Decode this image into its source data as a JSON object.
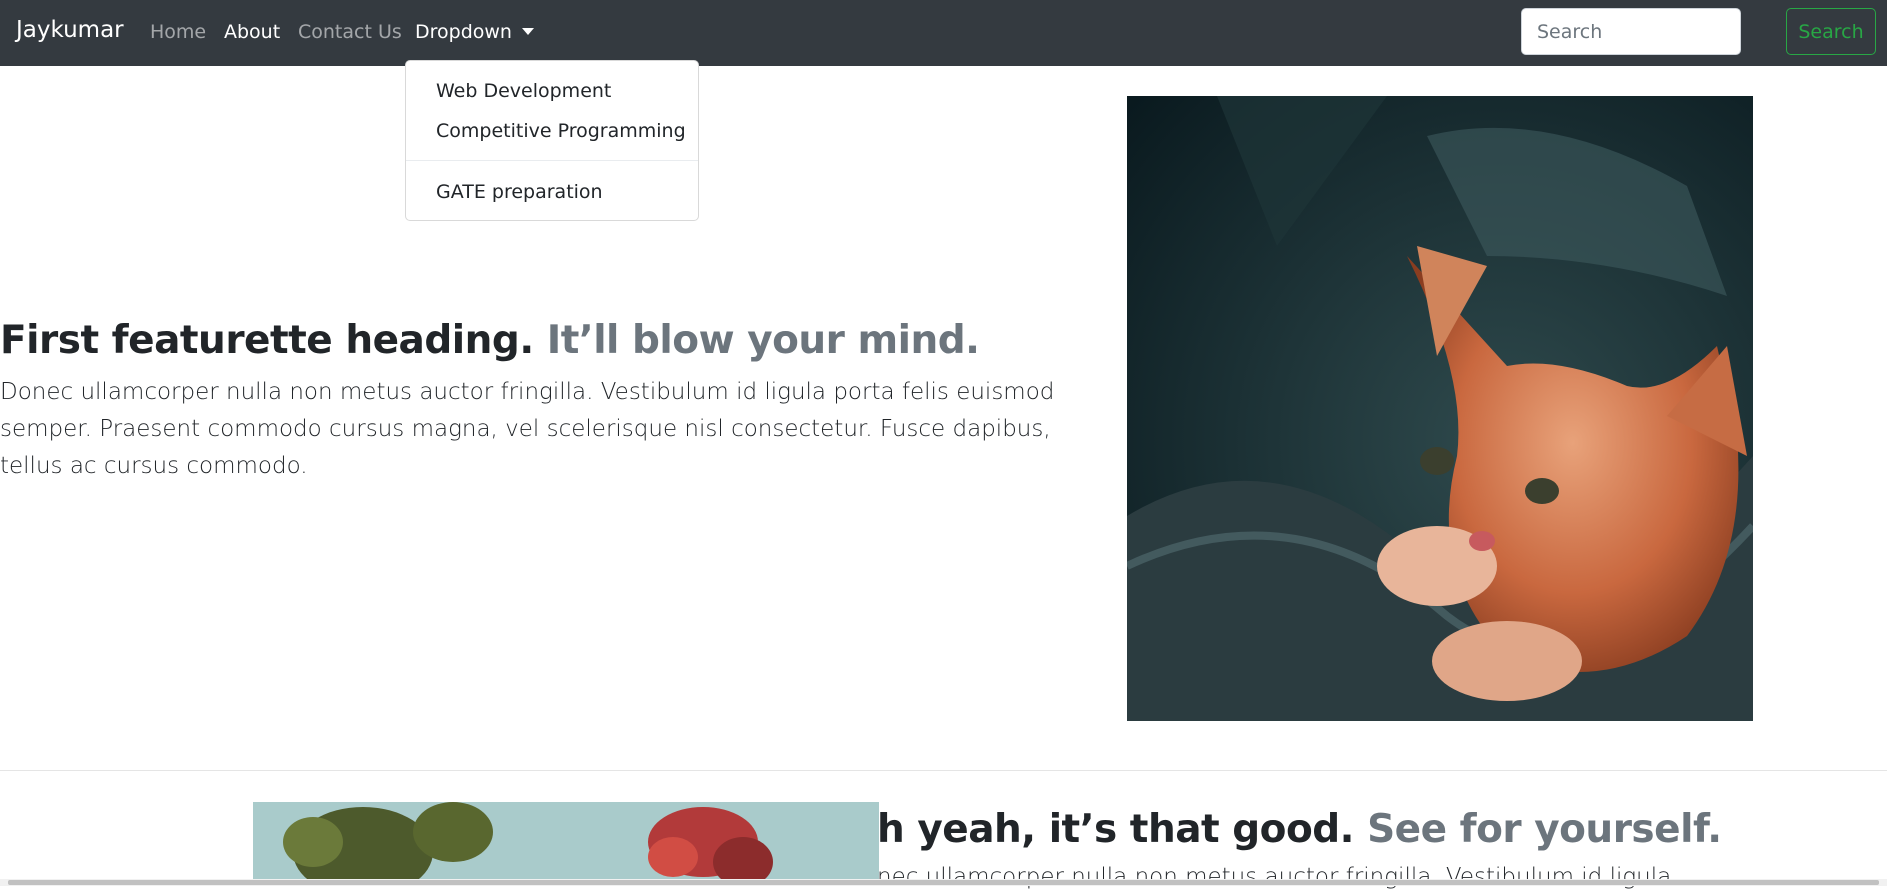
{
  "navbar": {
    "brand": "Jaykumar",
    "links": [
      {
        "label": "Home"
      },
      {
        "label": "About"
      },
      {
        "label": "Contact Us"
      },
      {
        "label": "Dropdown"
      }
    ],
    "search": {
      "placeholder": "Search",
      "button_label": "Search"
    }
  },
  "dropdown": {
    "items": [
      "Web Development",
      "Competitive Programming"
    ],
    "after_divider": "GATE preparation"
  },
  "featurette1": {
    "heading": "First featurette heading.",
    "heading_muted": "It’ll blow your mind.",
    "lead": "Donec ullamcorper nulla non metus auctor fringilla. Vestibulum id ligula porta felis euismod semper. Praesent commodo cursus magna, vel scelerisque nisl consectetur. Fusce dapibus, tellus ac cursus commodo."
  },
  "featurette2": {
    "heading": "h yeah, it’s that good.",
    "heading_muted": "See for yourself.",
    "lead": "nec ullamcorper nulla non metus auctor fringilla. Vestibulum id ligula"
  },
  "colors": {
    "navbar": "#343a40",
    "success": "#28a745",
    "muted": "#6c757d"
  }
}
